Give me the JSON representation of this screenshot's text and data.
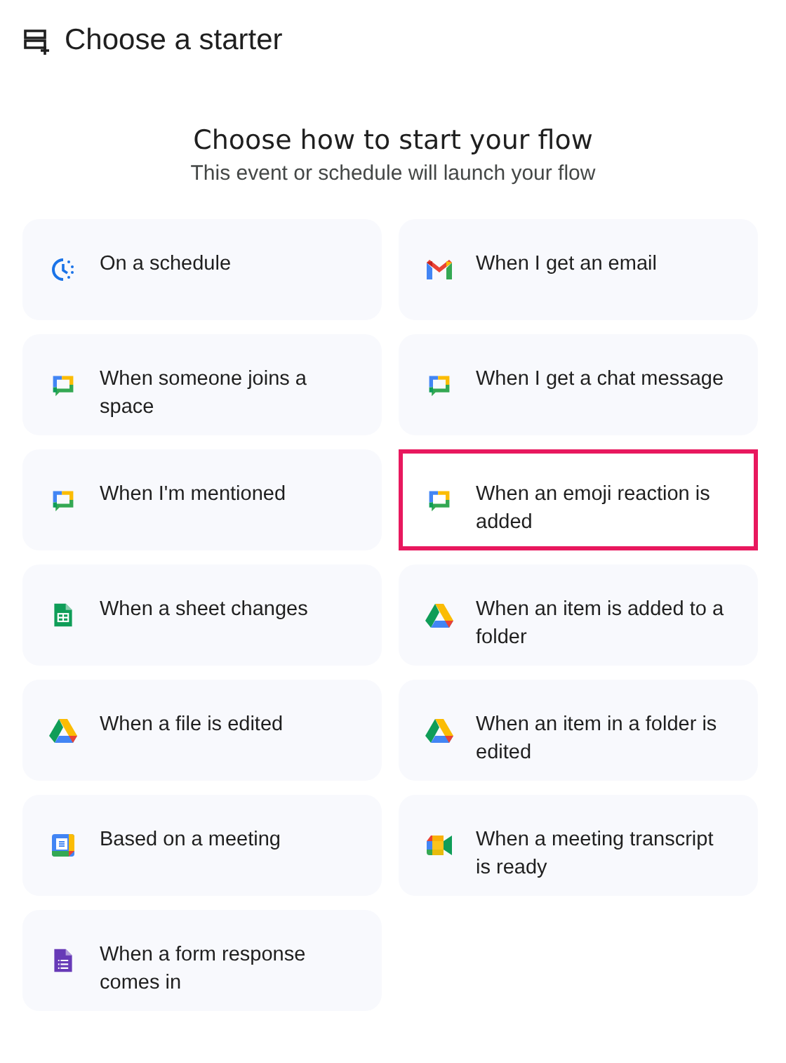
{
  "header": {
    "title": "Choose a starter"
  },
  "intro": {
    "heading": "Choose how to start your flow",
    "subtitle": "This event or schedule will launch your flow"
  },
  "starters": [
    {
      "label": "On a schedule",
      "kind": "schedule",
      "highlighted": false
    },
    {
      "label": "When I get an email",
      "kind": "mail",
      "highlighted": false
    },
    {
      "label": "When someone joins a space",
      "kind": "chat",
      "highlighted": false
    },
    {
      "label": "When I get a chat message",
      "kind": "chat",
      "highlighted": false
    },
    {
      "label": "When I'm mentioned",
      "kind": "chat",
      "highlighted": false
    },
    {
      "label": "When an emoji reaction is added",
      "kind": "chat",
      "highlighted": true
    },
    {
      "label": "When a sheet changes",
      "kind": "sheet",
      "highlighted": false
    },
    {
      "label": "When an item is added to a folder",
      "kind": "drive",
      "highlighted": false
    },
    {
      "label": "When a file is edited",
      "kind": "drive",
      "highlighted": false
    },
    {
      "label": "When an item in a folder is edited",
      "kind": "drive",
      "highlighted": false
    },
    {
      "label": "Based on a meeting",
      "kind": "calendar",
      "highlighted": false
    },
    {
      "label": "When a meeting transcript is ready",
      "kind": "video",
      "highlighted": false
    },
    {
      "label": "When a form response comes in",
      "kind": "form",
      "highlighted": false
    }
  ]
}
